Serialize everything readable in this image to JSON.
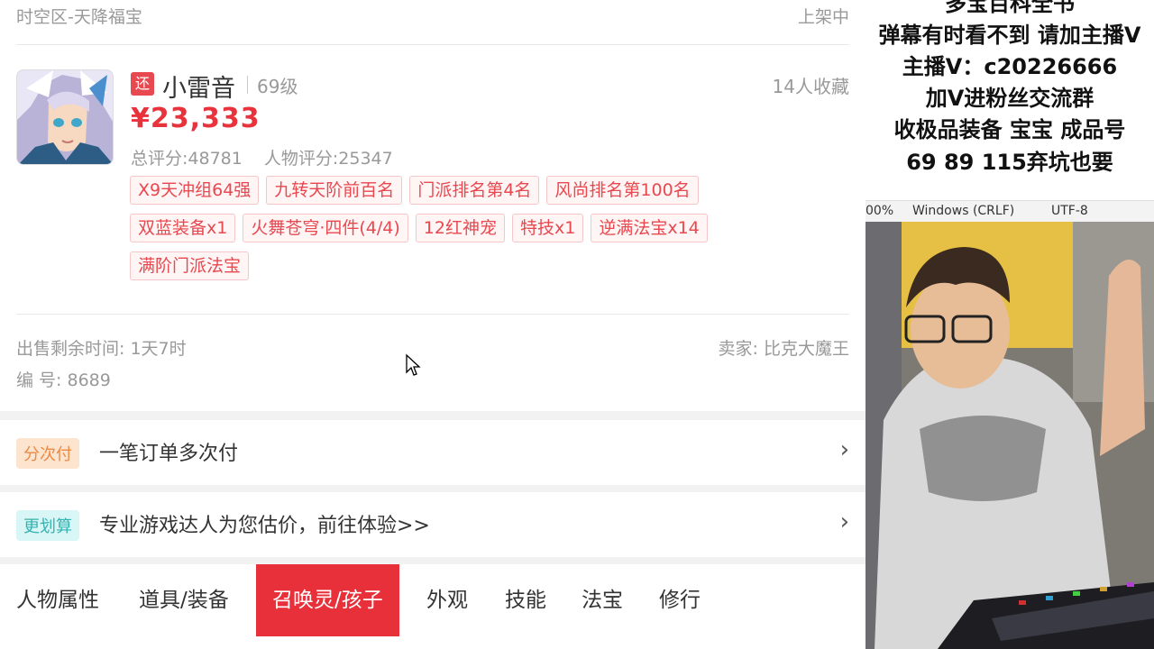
{
  "header": {
    "server": "时空区-天降福宝",
    "status": "上架中"
  },
  "character": {
    "return_badge": "还",
    "name": "小雷音",
    "level": "69级",
    "favorites": "14人收藏",
    "price": "¥23,333",
    "total_score": "总评分:48781",
    "char_score": "人物评分:25347"
  },
  "tags": [
    "X9天冲组64强",
    "九转天阶前百名",
    "门派排名第4名",
    "风尚排名第100名",
    "双蓝装备x1",
    "火舞苍穹·四件(4/4)",
    "12红神宠",
    "特技x1",
    "逆满法宝x14",
    "满阶门派法宝"
  ],
  "listing": {
    "remain": "出售剩余时间: 1天7时",
    "seller": "卖家: 比克大魔王",
    "serial": "编 号: 8689"
  },
  "installment": {
    "badge": "分次付",
    "text": "一笔订单多次付",
    "arrow": "›"
  },
  "estimate": {
    "badge": "更划算",
    "text": "专业游戏达人为您估价，前往体验>>",
    "arrow": "›"
  },
  "tabs": [
    "人物属性",
    "道具/装备",
    "召唤灵/孩子",
    "外观",
    "技能",
    "法宝",
    "修行"
  ],
  "active_tab": "召唤灵/孩子",
  "overlay": {
    "lines": [
      "多宝百科全书",
      "弹幕有时看不到 请加主播V",
      "主播V：c20226666",
      "加V进粉丝交流群",
      "收极品装备 宝宝 成品号",
      "69 89 115弃坑也要"
    ]
  },
  "editor_bar": {
    "zoom": "00%",
    "line_ending": "Windows (CRLF)",
    "encoding": "UTF-8"
  },
  "colors": {
    "accent": "#e8303a",
    "price": "#e8333d",
    "tag_border": "#f5c6c8"
  }
}
